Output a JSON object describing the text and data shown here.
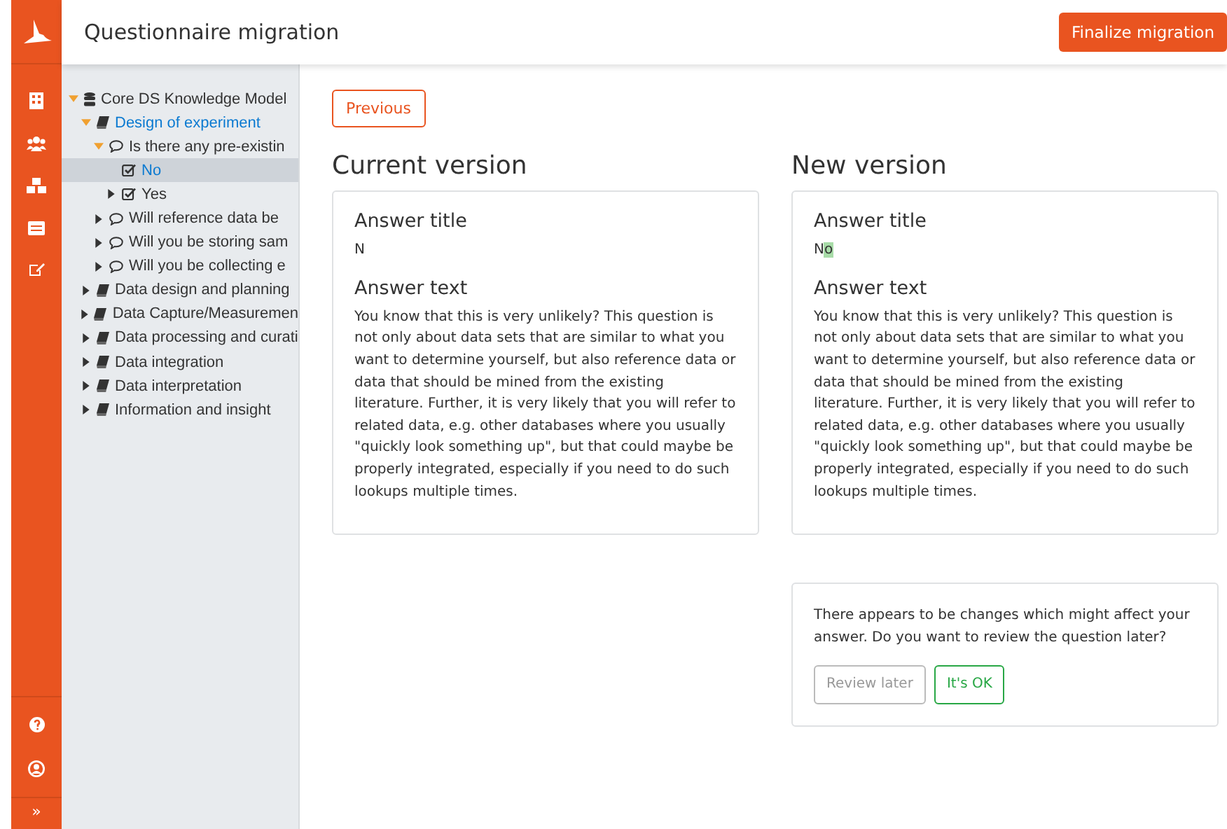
{
  "header": {
    "title": "Questionnaire migration",
    "action": "Finalize migration"
  },
  "sidebar": {
    "top_icons": [
      {
        "kind": "building"
      },
      {
        "kind": "users"
      },
      {
        "kind": "cubes"
      },
      {
        "kind": "list"
      },
      {
        "kind": "edit"
      }
    ],
    "bottom_icons": [
      {
        "kind": "help"
      },
      {
        "kind": "user"
      }
    ],
    "collapse": "»"
  },
  "tree": [
    {
      "label": "Core DS Knowledge Model",
      "kind": "database",
      "expanded": true,
      "selected": false,
      "children": [
        {
          "label": "Design of experiment",
          "kind": "book",
          "expanded": true,
          "selected": false,
          "active": true,
          "children": [
            {
              "label": "Is there any pre-existin",
              "kind": "comment",
              "expanded": true,
              "selected": false,
              "children": [
                {
                  "label": "No",
                  "kind": "check",
                  "selected": true
                },
                {
                  "label": "Yes",
                  "kind": "check",
                  "expanded": false,
                  "selected": false
                }
              ]
            },
            {
              "label": "Will reference data be",
              "kind": "comment",
              "expanded": false,
              "selected": false
            },
            {
              "label": "Will you be storing sam",
              "kind": "comment",
              "expanded": false,
              "selected": false
            },
            {
              "label": "Will you be collecting e",
              "kind": "comment",
              "expanded": false,
              "selected": false
            }
          ]
        },
        {
          "label": "Data design and planning",
          "kind": "book",
          "expanded": false,
          "selected": false
        },
        {
          "label": "Data Capture/Measuremen",
          "kind": "book",
          "expanded": false,
          "selected": false
        },
        {
          "label": "Data processing and curati",
          "kind": "book",
          "expanded": false,
          "selected": false
        },
        {
          "label": "Data integration",
          "kind": "book",
          "expanded": false,
          "selected": false
        },
        {
          "label": "Data interpretation",
          "kind": "book",
          "expanded": false,
          "selected": false
        },
        {
          "label": "Information and insight",
          "kind": "book",
          "expanded": false,
          "selected": false
        }
      ]
    }
  ],
  "previous_button": "Previous",
  "versions": [
    {
      "heading": "Current version",
      "title_label": "Answer title",
      "title_value": [
        {
          "text": "N",
          "kind": "same"
        }
      ],
      "text_label": "Answer text",
      "text_value": "You know that this is very unlikely? This question is not only about data sets that are similar to what you want to determine yourself, but also reference data or data that should be mined from the existing literature. Further, it is very likely that you will refer to related data, e.g. other databases where you usually \"quickly look something up\", but that could maybe be properly integrated, especially if you need to do such lookups multiple times."
    },
    {
      "heading": "New version",
      "title_label": "Answer title",
      "title_value": [
        {
          "text": "N",
          "kind": "same"
        },
        {
          "text": "o",
          "kind": "added"
        }
      ],
      "text_label": "Answer text",
      "text_value": "You know that this is very unlikely? This question is not only about data sets that are similar to what you want to determine yourself, but also reference data or data that should be mined from the existing literature. Further, it is very likely that you will refer to related data, e.g. other databases where you usually \"quickly look something up\", but that could maybe be properly integrated, especially if you need to do such lookups multiple times."
    }
  ],
  "review": {
    "message": "There appears to be changes which might affect your answer. Do you want to review the question later?",
    "buttons": [
      {
        "label": "Review later",
        "kind": "secondary"
      },
      {
        "label": "It's OK",
        "kind": "success"
      }
    ]
  }
}
